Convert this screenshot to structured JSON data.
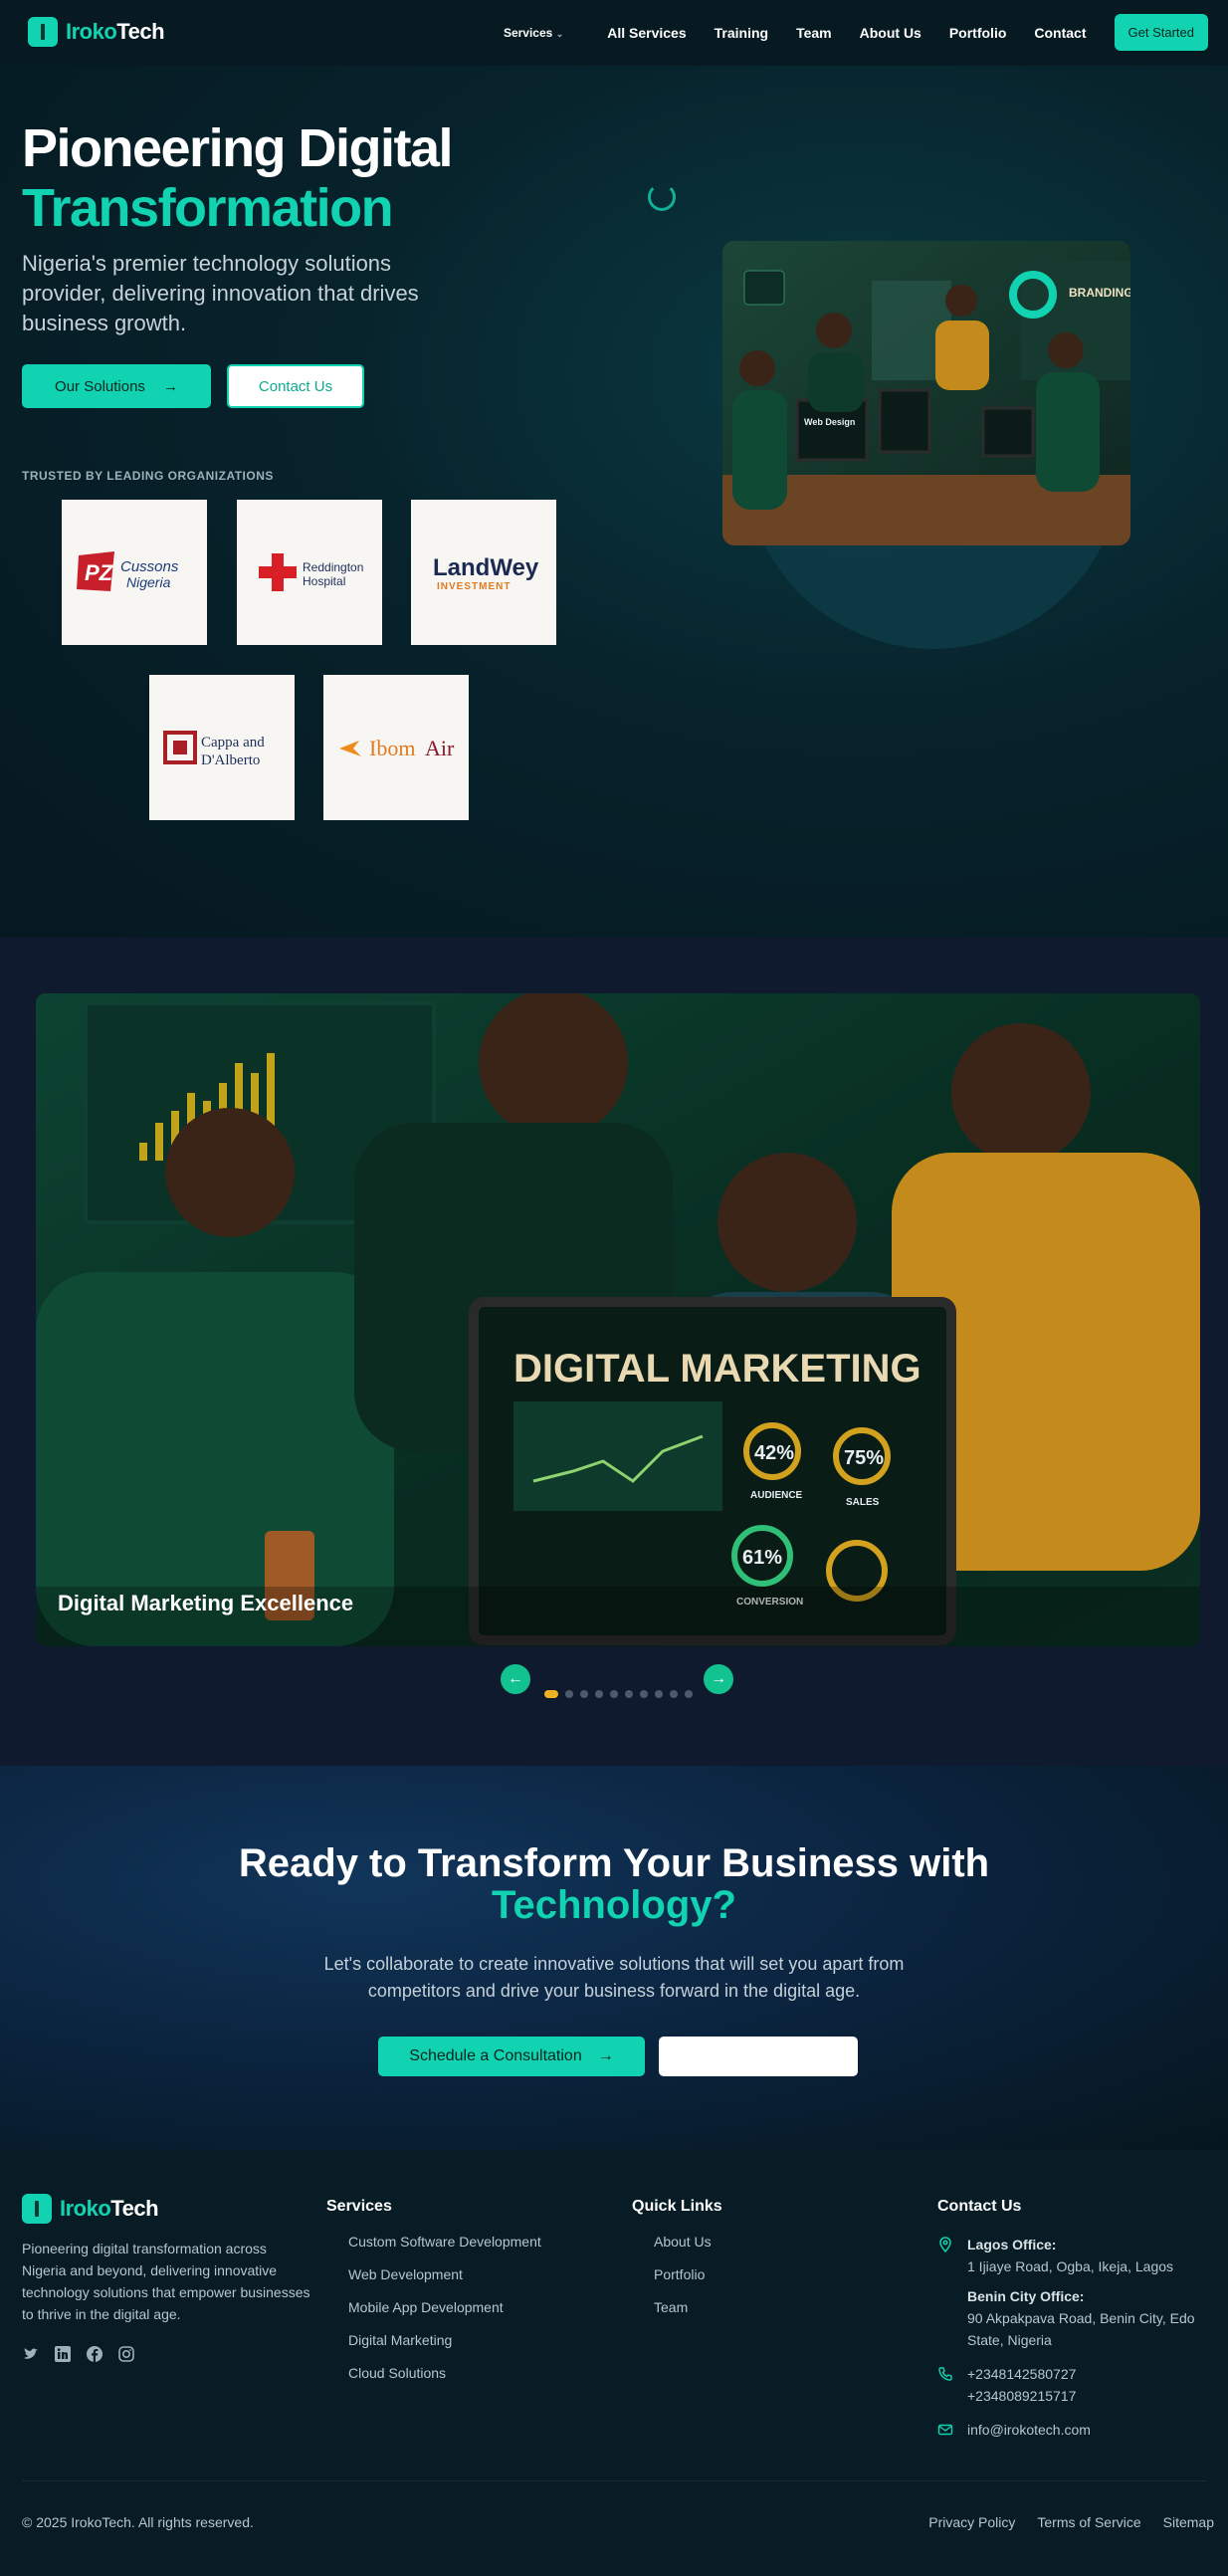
{
  "brand": {
    "name_a": "Iroko",
    "name_b": "Tech"
  },
  "nav": {
    "services": "Services",
    "links": [
      "All Services",
      "Training",
      "Team",
      "About Us",
      "Portfolio",
      "Contact"
    ],
    "cta": "Get Started"
  },
  "hero": {
    "title_line1": "Pioneering Digital",
    "title_line2": "Transformation",
    "subtitle": "Nigeria's premier technology solutions provider, delivering innovation that drives business growth.",
    "btn_solutions": "Our Solutions",
    "btn_contact": "Contact Us",
    "trusted_label": "TRUSTED BY LEADING ORGANIZATIONS",
    "partners": [
      "PZ Cussons Nigeria",
      "Reddington Hospital",
      "LandWey INVESTMENT",
      "Cappa and D'Alberto",
      "Ibom Air"
    ],
    "image_labels": {
      "web_design": "Web Design",
      "branding": "BRANDING"
    }
  },
  "carousel": {
    "caption": "Digital Marketing Excellence",
    "screen_title": "DIGITAL MARKETING",
    "metrics": [
      {
        "label": "AUDIENCE",
        "value": "42%"
      },
      {
        "label": "SALES",
        "value": "75%"
      },
      {
        "label": "CONVERSION",
        "value": "61%"
      }
    ],
    "dot_count": 10,
    "active_dot": 0
  },
  "cta": {
    "title_line1": "Ready to Transform Your Business with",
    "title_line2": "Technology?",
    "subtitle": "Let's collaborate to create innovative solutions that will set you apart from competitors and drive your business forward in the digital age.",
    "btn_schedule": "Schedule a Consultation"
  },
  "footer": {
    "description": "Pioneering digital transformation across Nigeria and beyond, delivering innovative technology solutions that empower businesses to thrive in the digital age.",
    "services_title": "Services",
    "services": [
      "Custom Software Development",
      "Web Development",
      "Mobile App Development",
      "Digital Marketing",
      "Cloud Solutions"
    ],
    "quick_title": "Quick Links",
    "quick_links": [
      "About Us",
      "Portfolio",
      "Team"
    ],
    "contact_title": "Contact Us",
    "lagos_label": "Lagos Office:",
    "lagos_addr": "1 Ijiaye Road, Ogba, Ikeja, Lagos",
    "benin_label": "Benin City Office:",
    "benin_addr": "90 Akpakpava Road, Benin City, Edo State, Nigeria",
    "phone1": "+2348142580727",
    "phone2": "+2348089215717",
    "email": "info@irokotech.com",
    "copyright": "© 2025 IrokoTech. All rights reserved.",
    "bottom_links": [
      "Privacy Policy",
      "Terms of Service",
      "Sitemap"
    ]
  }
}
